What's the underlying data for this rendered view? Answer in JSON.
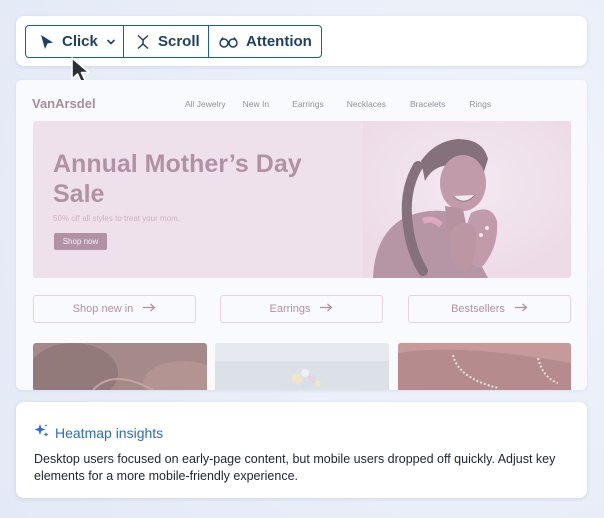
{
  "toolbar": {
    "modes": [
      {
        "label": "Click",
        "icon": "cursor-arrow-icon",
        "has_dropdown": true,
        "active": true
      },
      {
        "label": "Scroll",
        "icon": "scroll-arrows-icon"
      },
      {
        "label": "Attention",
        "icon": "glasses-icon"
      }
    ],
    "accent": "#1e5f8d"
  },
  "site": {
    "brand": "VanArsdel",
    "nav": [
      "All Jewelry",
      "New In",
      "Earrings",
      "Necklaces",
      "Bracelets",
      "Rings"
    ],
    "hero": {
      "title": "Annual Mother’s Day Sale",
      "subtitle": "50% off all styles to treat your mom.",
      "button": "Shop now"
    },
    "ctas": [
      "Shop new in",
      "Earrings",
      "Bestsellers"
    ]
  },
  "insights": {
    "title": "Heatmap insights",
    "body": "Desktop users focused on early-page content, but mobile users dropped off quickly. Adjust key elements for a more mobile-friendly experience.",
    "icon": "sparkle-icon",
    "accent": "#2a6bd0"
  }
}
